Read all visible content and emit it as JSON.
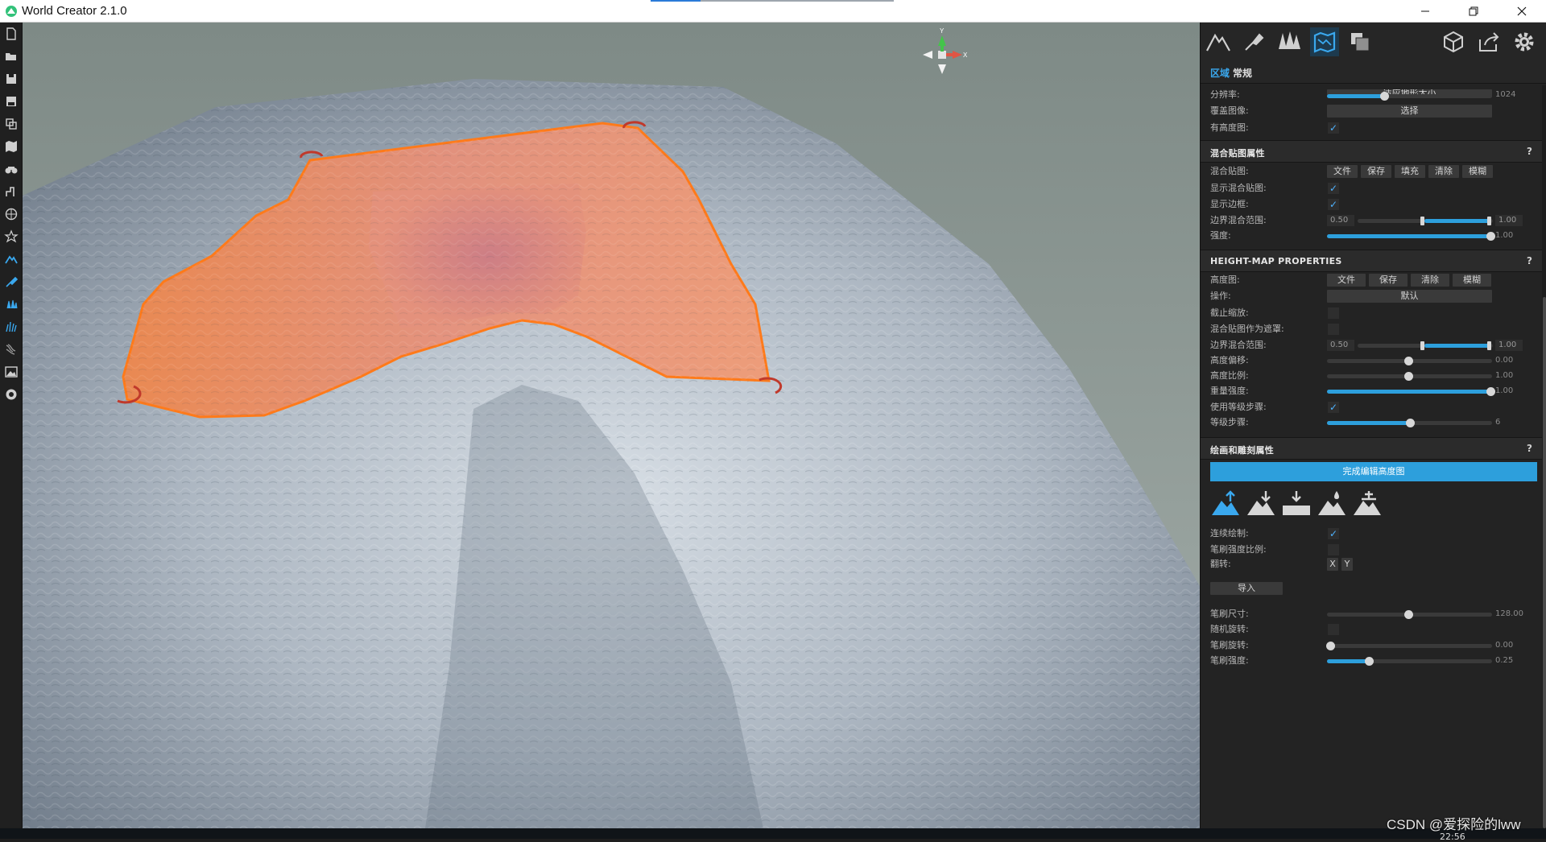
{
  "window": {
    "title": "World Creator 2.1.0",
    "minimize_icon": "minimize-icon",
    "maximize_icon": "restore-icon",
    "close_icon": "close-icon"
  },
  "left_toolbar": {
    "icons": [
      "new-file-icon",
      "open-folder-icon",
      "save-icon",
      "save-as-icon",
      "export-icon",
      "map-icon",
      "binoculars-icon",
      "terrain-tool-icon",
      "globe-icon",
      "settings-star-icon",
      "sculpt-active-icon",
      "paint-brush-icon",
      "vegetation-icon",
      "grass-icon",
      "erosion-icon",
      "image-icon",
      "sphere-icon"
    ]
  },
  "viewport": {
    "gizmo": {
      "y_label": "Y",
      "x_label": "X"
    },
    "colors": {
      "terrain_sky": "#8a9793",
      "region_fill": "#f08a4e",
      "region_edge": "#ff7a1a",
      "handle": "#c43a3a"
    }
  },
  "panel": {
    "top_icons": [
      "terrain-icon",
      "sculpt-tool-icon",
      "forest-icon",
      "map-region-icon",
      "layers-icon",
      "cube-icon",
      "export-share-icon",
      "gear-icon"
    ],
    "tabs": {
      "region": "区域",
      "general": "常规"
    },
    "top_rows": {
      "fit_button": "适应地形大小",
      "resolution_label": "分辨率:",
      "resolution_value": "1024",
      "resolution_fraction": 0.35,
      "overlay_label": "覆盖图像:",
      "overlay_button": "选择",
      "has_heightmap_label": "有高度图:"
    },
    "blend_section": {
      "title": "混合贴图属性",
      "help": "?",
      "blendmap_label": "混合贴图:",
      "buttons": [
        "文件",
        "保存",
        "填充",
        "清除",
        "模糊"
      ],
      "show_blend_label": "显示混合贴图:",
      "show_border_label": "显示边框:",
      "border_range_label": "边界混合范围:",
      "border_min": "0.50",
      "border_max": "1.00",
      "strength_label": "强度:",
      "strength_value": "1.00"
    },
    "heightmap_section": {
      "title": "HEIGHT-MAP PROPERTIES",
      "help": "?",
      "heightmap_label": "高度图:",
      "buttons": [
        "文件",
        "保存",
        "清除",
        "模糊"
      ],
      "operation_label": "操作:",
      "operation_value": "默认",
      "clip_scale_label": "截止缩放:",
      "blend_mask_label": "混合贴图作为遮罩:",
      "border_range_label": "边界混合范围:",
      "border_min": "0.50",
      "border_max": "1.00",
      "height_offset_label": "高度偏移:",
      "height_offset_value": "0.00",
      "height_scale_label": "高度比例:",
      "height_scale_value": "1.00",
      "weight_strength_label": "重量强度:",
      "weight_strength_value": "1.00",
      "use_steps_label": "使用等级步骤:",
      "steps_label": "等级步骤:",
      "steps_value": "6"
    },
    "paint_section": {
      "title": "绘画和雕刻属性",
      "help": "?",
      "finish_button": "完成编辑高度图",
      "brush_icons": [
        "raise-terrain-icon",
        "lower-terrain-icon",
        "flatten-terrain-icon",
        "smooth-terrain-icon",
        "stamp-terrain-icon"
      ],
      "continuous_label": "连续绘制:",
      "pressure_label": "笔刷强度比例:",
      "flip_label": "翻转:",
      "flip_x": "X",
      "flip_y": "Y",
      "import_button": "导入",
      "brush_size_label": "笔刷尺寸:",
      "brush_size_value": "128.00",
      "random_rotation_label": "随机旋转:",
      "brush_rotation_label": "笔刷旋转:",
      "brush_rotation_value": "0.00",
      "brush_strength_label": "笔刷强度:",
      "brush_strength_value": "0.25"
    },
    "accent_color": "#2d9fdc"
  },
  "watermark": "CSDN @爱探险的lww",
  "taskbar_clock": "22:56"
}
